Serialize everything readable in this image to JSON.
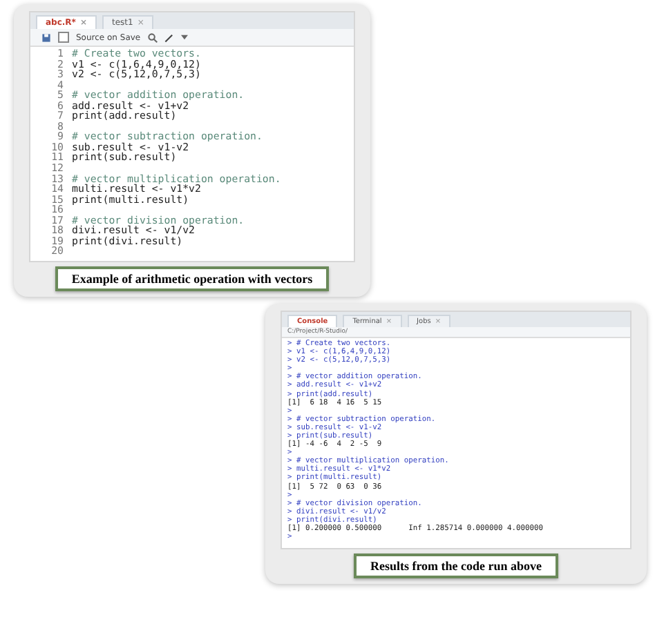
{
  "editor": {
    "tabs": [
      {
        "label": "abc.R*",
        "selected": true,
        "close": "×"
      },
      {
        "label": "test1",
        "selected": false,
        "close": "×"
      }
    ],
    "toolbar": {
      "source_on_save": {
        "label": "Source on Save",
        "checked": false
      }
    },
    "lines": [
      {
        "number": "1",
        "text": "# Create two vectors.",
        "kind": "comment"
      },
      {
        "number": "2",
        "text": "v1 <- c(1,6,4,9,0,12)",
        "kind": "code"
      },
      {
        "number": "3",
        "text": "v2 <- c(5,12,0,7,5,3)",
        "kind": "code"
      },
      {
        "number": "4"
      },
      {
        "number": "5",
        "text": "# vector addition operation.",
        "kind": "comment"
      },
      {
        "number": "6",
        "text": "add.result <- v1+v2",
        "kind": "code"
      },
      {
        "number": "7",
        "text": "print(add.result)",
        "kind": "code"
      },
      {
        "number": "8"
      },
      {
        "number": "9",
        "text": "# vector subtraction operation.",
        "kind": "comment"
      },
      {
        "number": "10",
        "text": "sub.result <- v1-v2",
        "kind": "code"
      },
      {
        "number": "11",
        "text": "print(sub.result)",
        "kind": "code"
      },
      {
        "number": "12"
      },
      {
        "number": "13",
        "text": "# vector multiplication operation.",
        "kind": "comment"
      },
      {
        "number": "14",
        "text": "multi.result <- v1*v2",
        "kind": "code"
      },
      {
        "number": "15",
        "text": "print(multi.result)",
        "kind": "code"
      },
      {
        "number": "16"
      },
      {
        "number": "17",
        "text": "# vector division operation.",
        "kind": "comment"
      },
      {
        "number": "18",
        "text": "divi.result <- v1/v2",
        "kind": "code"
      },
      {
        "number": "19",
        "text": "print(divi.result)",
        "kind": "code"
      },
      {
        "number": "20"
      }
    ],
    "caption": "Example of arithmetic operation with vectors"
  },
  "console": {
    "tabs": [
      {
        "label": "Console",
        "selected": true
      },
      {
        "label": "Terminal",
        "selected": false,
        "close": "×"
      },
      {
        "label": "Jobs",
        "selected": false,
        "close": "×"
      }
    ],
    "path": "C:/Project/R-Studio/",
    "lines": [
      {
        "text": "> # Create two vectors.",
        "kind": "input"
      },
      {
        "text": "> v1 <- c(1,6,4,9,0,12)",
        "kind": "input"
      },
      {
        "text": "> v2 <- c(5,12,0,7,5,3)",
        "kind": "input"
      },
      {
        "text": ">",
        "kind": "input"
      },
      {
        "text": "> # vector addition operation.",
        "kind": "input"
      },
      {
        "text": "> add.result <- v1+v2",
        "kind": "input"
      },
      {
        "text": "> print(add.result)",
        "kind": "input"
      },
      {
        "text": "[1]  6 18  4 16  5 15",
        "kind": "output"
      },
      {
        "text": ">",
        "kind": "input"
      },
      {
        "text": "> # vector subtraction operation.",
        "kind": "input"
      },
      {
        "text": "> sub.result <- v1-v2",
        "kind": "input"
      },
      {
        "text": "> print(sub.result)",
        "kind": "input"
      },
      {
        "text": "[1] -4 -6  4  2 -5  9",
        "kind": "output"
      },
      {
        "text": ">",
        "kind": "input"
      },
      {
        "text": "> # vector multiplication operation.",
        "kind": "input"
      },
      {
        "text": "> multi.result <- v1*v2",
        "kind": "input"
      },
      {
        "text": "> print(multi.result)",
        "kind": "input"
      },
      {
        "text": "[1]  5 72  0 63  0 36",
        "kind": "output"
      },
      {
        "text": ">",
        "kind": "input"
      },
      {
        "text": "> # vector division operation.",
        "kind": "input"
      },
      {
        "text": "> divi.result <- v1/v2",
        "kind": "input"
      },
      {
        "text": "> print(divi.result)",
        "kind": "input"
      },
      {
        "text": "[1] 0.200000 0.500000      Inf 1.285714 0.000000 4.000000",
        "kind": "output"
      },
      {
        "text": ">",
        "kind": "input"
      }
    ],
    "caption": "Results from the code run above"
  }
}
